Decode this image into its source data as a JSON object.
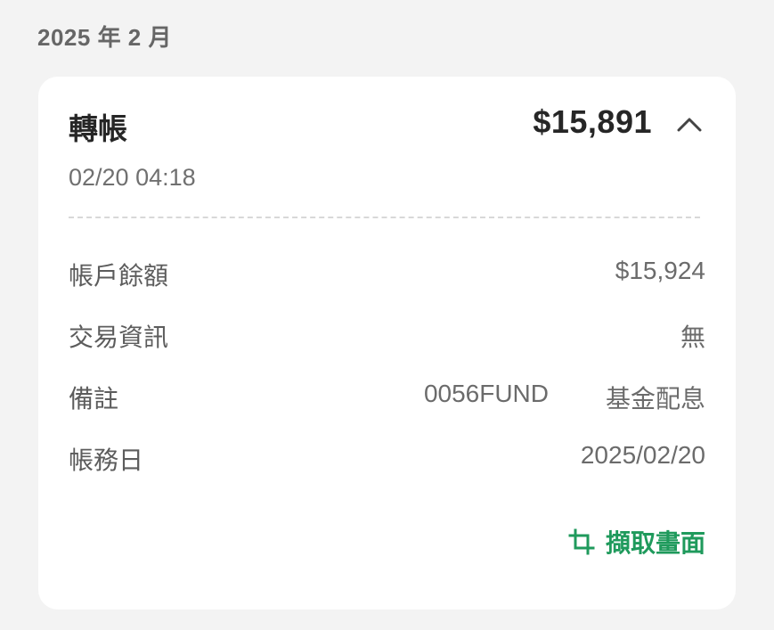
{
  "month_header": "2025 年 2 月",
  "transaction": {
    "type": "轉帳",
    "amount": "$15,891",
    "datetime": "02/20 04:18",
    "collapse_icon": "chevron-up-icon",
    "details": {
      "balance_label": "帳戶餘額",
      "balance_value": "$15,924",
      "info_label": "交易資訊",
      "info_value": "無",
      "memo_label": "備註",
      "memo_code": "0056FUND",
      "memo_text": "基金配息",
      "posting_date_label": "帳務日",
      "posting_date_value": "2025/02/20"
    },
    "screenshot_button": {
      "icon": "crop-icon",
      "label": "擷取畫面",
      "color": "#1f9a5c"
    }
  }
}
